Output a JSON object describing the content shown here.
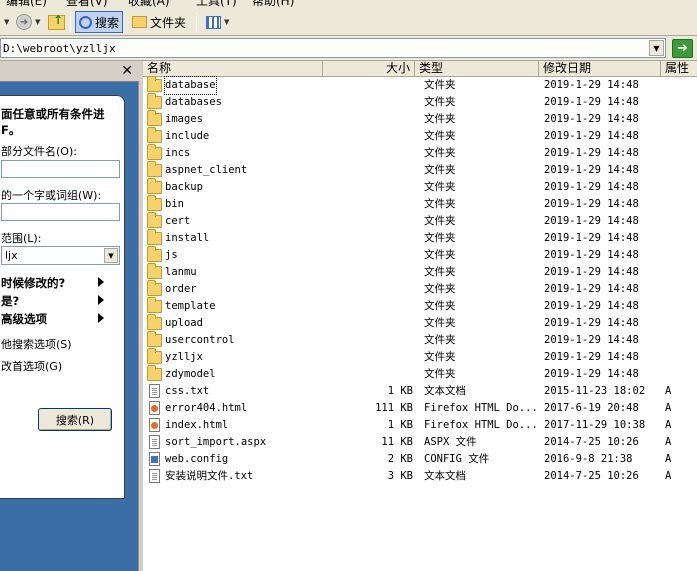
{
  "menu": {
    "edit": "编辑(E)",
    "view": "查看(V)",
    "favorites": "收藏(A)",
    "tools": "工具(T)",
    "help": "帮助(H)"
  },
  "toolbar": {
    "back_icon": "back-arrow-icon",
    "forward_icon": "forward-arrow-icon",
    "search_label": "搜索",
    "folders_label": "文件夹"
  },
  "address": {
    "path": "D:\\webroot\\yzlljx"
  },
  "search_pane": {
    "title_line1": "面任意或所有条件进",
    "title_line2": "F。",
    "partial_name_label": "部分文件名(O):",
    "word_label": "的一个字或词组(W):",
    "look_in_label": "范围(L):",
    "look_in_value": "ljx",
    "when_modified": "时候修改的?",
    "size_label": "是?",
    "advanced": "高级选项",
    "other_search": "他搜索选项(S)",
    "change_prefs": "改首选项(G)",
    "search_button": "搜索(R)"
  },
  "columns": {
    "name": "名称",
    "size": "大小",
    "type": "类型",
    "modified": "修改日期",
    "attr": "属性"
  },
  "files": [
    {
      "name": "database",
      "size": "",
      "type": "文件夹",
      "date": "2019-1-29 14:48",
      "attr": "",
      "icon": "folder-icon"
    },
    {
      "name": "databases",
      "size": "",
      "type": "文件夹",
      "date": "2019-1-29 14:48",
      "attr": "",
      "icon": "folder-icon"
    },
    {
      "name": "images",
      "size": "",
      "type": "文件夹",
      "date": "2019-1-29 14:48",
      "attr": "",
      "icon": "folder-icon"
    },
    {
      "name": "include",
      "size": "",
      "type": "文件夹",
      "date": "2019-1-29 14:48",
      "attr": "",
      "icon": "folder-icon"
    },
    {
      "name": "incs",
      "size": "",
      "type": "文件夹",
      "date": "2019-1-29 14:48",
      "attr": "",
      "icon": "folder-icon"
    },
    {
      "name": "aspnet_client",
      "size": "",
      "type": "文件夹",
      "date": "2019-1-29 14:48",
      "attr": "",
      "icon": "folder-icon"
    },
    {
      "name": "backup",
      "size": "",
      "type": "文件夹",
      "date": "2019-1-29 14:48",
      "attr": "",
      "icon": "folder-icon"
    },
    {
      "name": "bin",
      "size": "",
      "type": "文件夹",
      "date": "2019-1-29 14:48",
      "attr": "",
      "icon": "folder-icon"
    },
    {
      "name": "cert",
      "size": "",
      "type": "文件夹",
      "date": "2019-1-29 14:48",
      "attr": "",
      "icon": "folder-icon"
    },
    {
      "name": "install",
      "size": "",
      "type": "文件夹",
      "date": "2019-1-29 14:48",
      "attr": "",
      "icon": "folder-icon"
    },
    {
      "name": "js",
      "size": "",
      "type": "文件夹",
      "date": "2019-1-29 14:48",
      "attr": "",
      "icon": "folder-icon"
    },
    {
      "name": "lanmu",
      "size": "",
      "type": "文件夹",
      "date": "2019-1-29 14:48",
      "attr": "",
      "icon": "folder-icon"
    },
    {
      "name": "order",
      "size": "",
      "type": "文件夹",
      "date": "2019-1-29 14:48",
      "attr": "",
      "icon": "folder-icon"
    },
    {
      "name": "template",
      "size": "",
      "type": "文件夹",
      "date": "2019-1-29 14:48",
      "attr": "",
      "icon": "folder-icon"
    },
    {
      "name": "upload",
      "size": "",
      "type": "文件夹",
      "date": "2019-1-29 14:48",
      "attr": "",
      "icon": "folder-icon"
    },
    {
      "name": "usercontrol",
      "size": "",
      "type": "文件夹",
      "date": "2019-1-29 14:48",
      "attr": "",
      "icon": "folder-icon"
    },
    {
      "name": "yzlljx",
      "size": "",
      "type": "文件夹",
      "date": "2019-1-29 14:48",
      "attr": "",
      "icon": "folder-icon"
    },
    {
      "name": "zdymodel",
      "size": "",
      "type": "文件夹",
      "date": "2019-1-29 14:48",
      "attr": "",
      "icon": "folder-icon"
    },
    {
      "name": "css.txt",
      "size": "1 KB",
      "type": "文本文档",
      "date": "2015-11-23 18:02",
      "attr": "A",
      "icon": "text-file-icon"
    },
    {
      "name": "error404.html",
      "size": "111 KB",
      "type": "Firefox HTML Do...",
      "date": "2017-6-19 20:48",
      "attr": "A",
      "icon": "firefox-html-icon"
    },
    {
      "name": "index.html",
      "size": "1 KB",
      "type": "Firefox HTML Do...",
      "date": "2017-11-29 10:38",
      "attr": "A",
      "icon": "firefox-html-icon"
    },
    {
      "name": "sort_import.aspx",
      "size": "11 KB",
      "type": "ASPX 文件",
      "date": "2014-7-25 10:26",
      "attr": "A",
      "icon": "aspx-file-icon"
    },
    {
      "name": "web.config",
      "size": "2 KB",
      "type": "CONFIG 文件",
      "date": "2016-9-8 21:38",
      "attr": "A",
      "icon": "config-file-icon"
    },
    {
      "name": "安装说明文件.txt",
      "size": "3 KB",
      "type": "文本文档",
      "date": "2014-7-25 10:26",
      "attr": "A",
      "icon": "text-file-icon"
    }
  ]
}
